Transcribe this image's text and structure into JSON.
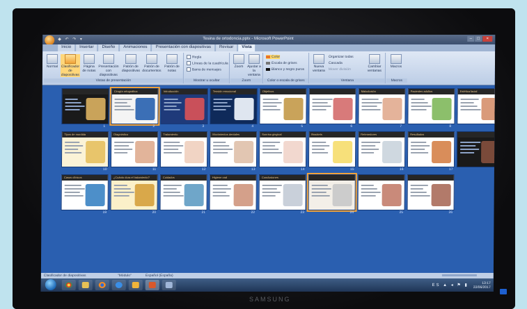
{
  "window": {
    "title": "Tesina de ortodoncia.pptx - Microsoft PowerPoint",
    "quick_access": "◆ ↶ ↷ ▾",
    "controls": [
      "–",
      "□",
      "×"
    ]
  },
  "ribbon": {
    "tabs": [
      "Inicio",
      "Insertar",
      "Diseño",
      "Animaciones",
      "Presentación con diapositivas",
      "Revisar",
      "Vista"
    ],
    "active_tab": "Vista",
    "groups": {
      "presentation_views": {
        "label": "Vistas de presentación",
        "buttons": [
          "Normal",
          "Clasificador de diapositivas",
          "Página de notas",
          "Presentación con diapositivas",
          "Patrón de diapositivas",
          "Patrón de documentos",
          "Patrón de notas"
        ]
      },
      "show_hide": {
        "label": "Mostrar u ocultar",
        "options": [
          "Regla",
          "Líneas de la cuadrícula",
          "Barra de mensajes"
        ]
      },
      "zoom": {
        "label": "Zoom",
        "buttons": [
          "Zoom",
          "Ajustar a la ventana"
        ]
      },
      "color": {
        "label": "Color o escala de grises",
        "options": [
          "Color",
          "Escala de grises",
          "Blanco y negro puros"
        ]
      },
      "window": {
        "label": "Ventana",
        "buttons": [
          "Nueva ventana",
          "Organizar todas",
          "Cascada",
          "Mover división",
          "Cambiar ventanas"
        ]
      },
      "macros": {
        "label": "Macros",
        "buttons": [
          "Macros"
        ]
      }
    }
  },
  "slides": [
    {
      "num": "1",
      "title": ""
    },
    {
      "num": "2",
      "title": "Cirugía ortognática"
    },
    {
      "num": "3",
      "title": "Introducción"
    },
    {
      "num": "4",
      "title": "Tensión emocional"
    },
    {
      "num": "5",
      "title": "Objetivos"
    },
    {
      "num": "6",
      "title": ""
    },
    {
      "num": "7",
      "title": "Maloclusión"
    },
    {
      "num": "8",
      "title": "Pacientes adultos"
    },
    {
      "num": "9",
      "title": "Estética facial"
    },
    {
      "num": "10",
      "title": "Tipos de mordida"
    },
    {
      "num": "11",
      "title": "Diagnóstico"
    },
    {
      "num": "12",
      "title": "Tratamiento"
    },
    {
      "num": "13",
      "title": "Movimientos dentales"
    },
    {
      "num": "14",
      "title": "Sonrisa gingival"
    },
    {
      "num": "15",
      "title": "Brackets"
    },
    {
      "num": "16",
      "title": "Retenedores"
    },
    {
      "num": "17",
      "title": "Resultados"
    },
    {
      "num": "18",
      "title": ""
    },
    {
      "num": "19",
      "title": "Casos clínicos"
    },
    {
      "num": "20",
      "title": "¿Cuánto dura el tratamiento?"
    },
    {
      "num": "21",
      "title": "Cuidados"
    },
    {
      "num": "22",
      "title": "Higiene oral"
    },
    {
      "num": "23",
      "title": "Conclusiones"
    },
    {
      "num": "24",
      "title": ""
    },
    {
      "num": "25",
      "title": ""
    },
    {
      "num": "26",
      "title": ""
    }
  ],
  "statusbar": {
    "view": "Clasificador de diapositivas",
    "theme": "\"Módulo\"",
    "language": "Español (España)"
  },
  "taskbar": {
    "time": "13:17",
    "date": "22/06/2017",
    "tray_icons": "ES ▲ ◂ ⚑ ▮"
  },
  "monitor": {
    "brand": "SAMSUNG"
  }
}
